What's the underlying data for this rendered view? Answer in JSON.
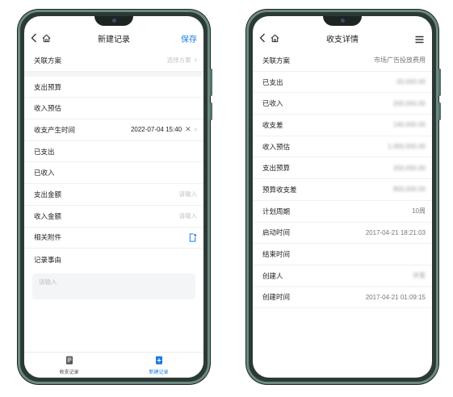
{
  "left": {
    "title": "新建记录",
    "save_label": "保存",
    "rows": [
      {
        "label": "关联方案",
        "placeholder": "选择方案"
      },
      {
        "label": "支出预算"
      },
      {
        "label": "收入预估"
      },
      {
        "label": "收支产生时间",
        "value": "2022-07-04 15:40"
      },
      {
        "label": "已支出"
      },
      {
        "label": "已收入"
      },
      {
        "label": "支出金额",
        "placeholder": "请输入"
      },
      {
        "label": "收入金额",
        "placeholder": "请输入"
      },
      {
        "label": "相关附件"
      },
      {
        "label": "记录事由"
      }
    ],
    "textarea_placeholder": "请输入",
    "tabs": [
      {
        "label": "收支记录",
        "icon": "list-doc-icon"
      },
      {
        "label": "新建记录",
        "icon": "new-doc-icon"
      }
    ]
  },
  "right": {
    "title": "收支详情",
    "rows": [
      {
        "label": "关联方案",
        "value": "市场广告投放费用"
      },
      {
        "label": "已支出",
        "value": "00,000.00"
      },
      {
        "label": "已收入",
        "value": "200,000.00"
      },
      {
        "label": "收支差",
        "value": "140,000.00"
      },
      {
        "label": "收入预估",
        "value": "1,000,000.00"
      },
      {
        "label": "支出预算",
        "value": "200,000.00"
      },
      {
        "label": "预算收支差",
        "value": "800,000.00"
      },
      {
        "label": "计划周期",
        "value": "10周"
      },
      {
        "label": "启动时间",
        "value": "2017-04-21 18:21:03"
      },
      {
        "label": "结束时间",
        "value": ""
      },
      {
        "label": "创建人",
        "value": "许某"
      },
      {
        "label": "创建时间",
        "value": "2017-04-21 01:09:15"
      }
    ]
  },
  "colors": {
    "accent": "#1a7ae0",
    "frame": "#2c3a37"
  }
}
